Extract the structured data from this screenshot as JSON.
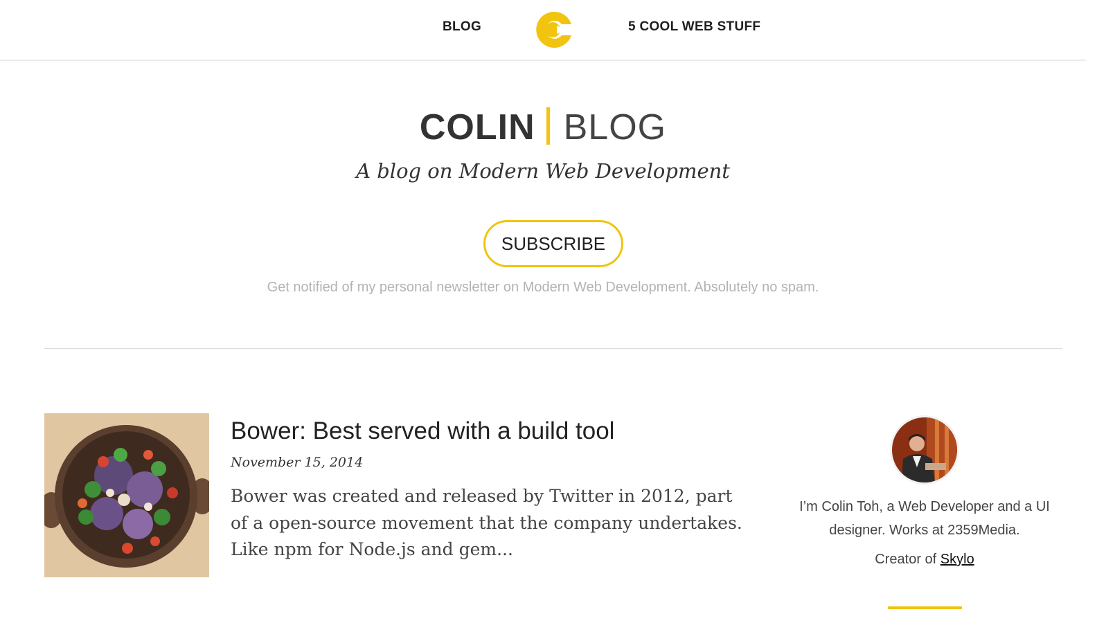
{
  "nav": {
    "blog_label": "BLOG",
    "cool_label": "5 COOL WEB STUFF",
    "logo_icon": "c-logo-icon"
  },
  "hero": {
    "title_bold": "COLIN",
    "title_light": "BLOG",
    "tagline": "A blog on Modern Web Development",
    "subscribe_label": "SUBSCRIBE",
    "notify_text": "Get notified of my personal newsletter on Modern Web Development. Absolutely no spam."
  },
  "post": {
    "title": "Bower: Best served with a build tool",
    "date": "November 15, 2014",
    "excerpt": "Bower was created and released by Twitter in 2012, part of a open-source movement that the company undertakes. Like npm for Node.js and gem...",
    "thumbnail_icon": "salad-bowl-image"
  },
  "author": {
    "bio": "I’m Colin Toh, a Web Developer and a UI designer. Works at 2359Media.",
    "creator_prefix": "Creator of ",
    "creator_link": "Skylo",
    "avatar_icon": "author-avatar-image"
  },
  "colors": {
    "accent": "#f1c40f",
    "text": "#333333",
    "muted": "#b3b3b3"
  }
}
